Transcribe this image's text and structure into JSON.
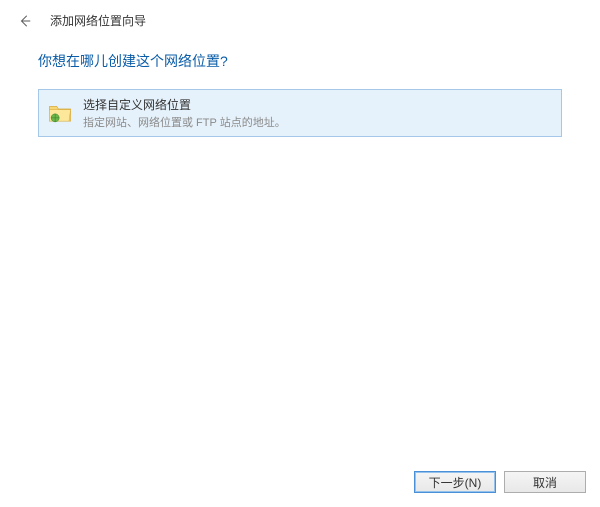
{
  "header": {
    "window_title": "添加网络位置向导"
  },
  "content": {
    "heading": "你想在哪儿创建这个网络位置?",
    "option": {
      "title": "选择自定义网络位置",
      "description": "指定网站、网络位置或 FTP 站点的地址。"
    }
  },
  "buttons": {
    "next": "下一步(N)",
    "cancel": "取消"
  }
}
